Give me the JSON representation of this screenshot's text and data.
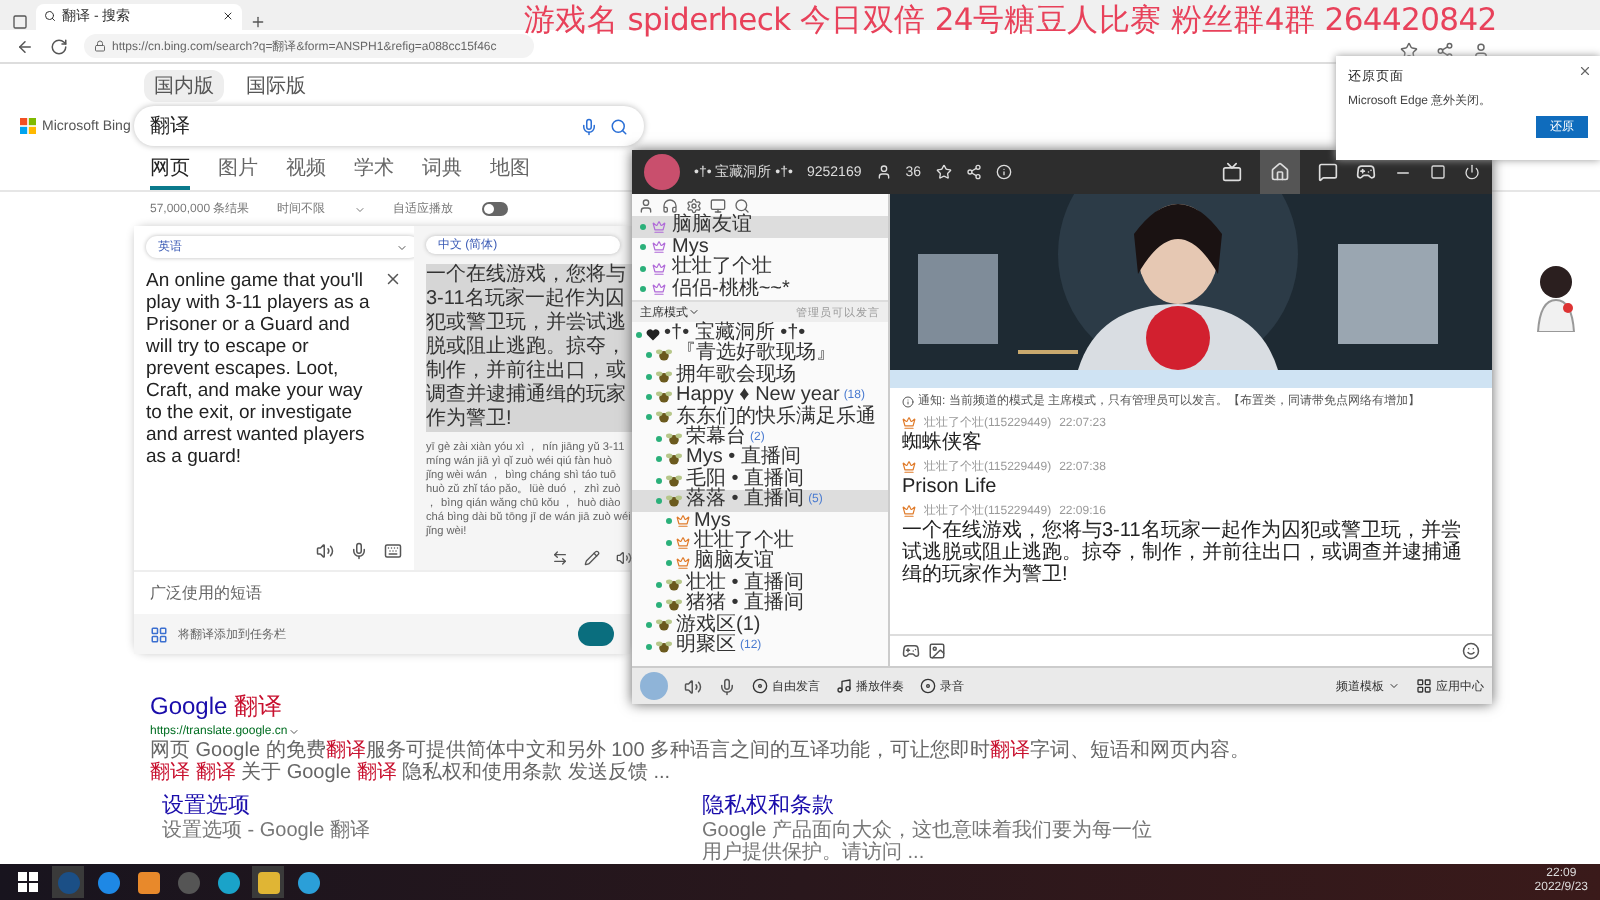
{
  "browser": {
    "tab_title": "翻译 - 搜索",
    "url": "https://cn.bing.com/search?q=翻译&form=ANSPH1&refig=a088cc15f46c"
  },
  "stream_overlay": "游戏名 spiderheck 今日双倍 24号糖豆人比赛 粉丝群4群 264420842",
  "bing": {
    "region_tabs": [
      {
        "label": "国内版",
        "selected": true
      },
      {
        "label": "国际版",
        "selected": false
      }
    ],
    "logo": "Microsoft Bing",
    "query": "翻译",
    "nav": [
      {
        "label": "网页",
        "selected": true
      },
      {
        "label": "图片",
        "selected": false
      },
      {
        "label": "视频",
        "selected": false
      },
      {
        "label": "学术",
        "selected": false
      },
      {
        "label": "词典",
        "selected": false
      },
      {
        "label": "地图",
        "selected": false
      }
    ],
    "result_count": "57,000,000 条结果",
    "time_filter": "时间不限",
    "autoplay": {
      "label": "自适应播放",
      "on": false
    },
    "translator": {
      "source_lang": "英语",
      "source_text": "An online game that you'll play with 3-11 players as a Prisoner or a Guard and will try to escape or prevent escapes. Loot, Craft, and make your way to the exit, or investigate and arrest wanted players as a guard!",
      "target_lang": "中文 (简体)",
      "target_text": "一个在线游戏，您将与3-11名玩家一起作为囚犯或警卫玩，并尝试逃脱或阻止逃跑。掠夺，制作，并前往出口，或调查并逮捕通缉的玩家作为警卫!",
      "pinyin": "yī gè zài xiàn yóu xì ， nín jiāng yǔ 3-11 míng wán jiā yì qǐ zuò wéi qiú fàn huò jǐng wèi wán ， bìng cháng shì táo tuō huò zǔ zhǐ táo pǎo。lüè duó ， zhì zuò ， bìng qián wǎng chū kǒu ， huò diào chá bìng dài bǔ tōng jī de wán jiā zuò wéi jǐng wèi!",
      "phrases_heading": "广泛使用的短语",
      "taskbar_prompt": "将翻译添加到任务栏"
    },
    "result": {
      "title": "Google **翻译**",
      "url": "https://translate.google.cn",
      "snippet": "网页 Google 的免费**翻译**服务可提供简体中文和另外 100 多种语言之间的互译功能，可让您即时**翻译**字词、短语和网页内容。**翻译** **翻译** 关于 Google **翻译** 隐私权和使用条款 发送反馈 ...",
      "sitelinks": [
        {
          "title": "设置选项",
          "description": "设置选项 - Google 翻译"
        },
        {
          "title": "隐私权和条款",
          "description": "Google 产品面向大众，这也意味着我们要为每一位用户提供保护。请访问 ..."
        }
      ]
    }
  },
  "edge_popup": {
    "title": "还原页面",
    "message": "Microsoft Edge 意外关闭。",
    "button": "还原"
  },
  "yy": {
    "channel_name": "•†• 宝藏洞所 •†•",
    "channel_id": "9252169",
    "online_count": "36",
    "members": [
      {
        "name": "脑脑友谊",
        "selected": true
      },
      {
        "name": "Mys",
        "selected": false
      },
      {
        "name": "壮壮了个壮",
        "selected": false
      },
      {
        "name": "侣侣-桃桃~~*",
        "selected": false
      }
    ],
    "mode": "主席模式",
    "mode_note": "管理员可以发言",
    "tree": [
      {
        "label": "•†• 宝藏洞所 •†•",
        "kind": "root",
        "selected": false,
        "children": [
          {
            "label": "『青选好歌现场』",
            "kind": "channel",
            "selected": false
          },
          {
            "label": "拥年歌会现场",
            "kind": "channel",
            "selected": false
          },
          {
            "label": "Happy ♦ New year",
            "count": "(18)",
            "kind": "channel",
            "selected": false
          },
          {
            "label": "东东们的快乐满足乐通",
            "kind": "channel",
            "selected": false,
            "children": [
              {
                "label": "荣幕台",
                "count": "(2)",
                "kind": "channel",
                "selected": false
              },
              {
                "label": "Mys • 直播间",
                "kind": "channel",
                "selected": false
              },
              {
                "label": "毛阳 • 直播间",
                "kind": "channel",
                "selected": false
              },
              {
                "label": "落落 • 直播间",
                "count": "(5)",
                "kind": "channel",
                "selected": true,
                "children": [
                  {
                    "label": "Mys",
                    "kind": "user",
                    "selected": false
                  },
                  {
                    "label": "壮壮了个壮",
                    "kind": "user",
                    "selected": false
                  },
                  {
                    "label": "脑脑友谊",
                    "kind": "user",
                    "selected": false
                  }
                ]
              },
              {
                "label": "壮壮 • 直播间",
                "kind": "channel",
                "selected": false
              },
              {
                "label": "猪猪 • 直播间",
                "kind": "channel",
                "selected": false
              }
            ]
          },
          {
            "label": "游戏区(1)",
            "kind": "channel",
            "selected": false
          },
          {
            "label": "明聚区",
            "count": "(12)",
            "kind": "channel",
            "selected": false
          }
        ]
      }
    ],
    "notice": "通知: 当前频道的模式是 主席模式，只有管理员可以发言。【布置类，同请带免点网络有增加】",
    "messages": [
      {
        "author": "壮壮了个壮(115229449)",
        "time": "22:07:23",
        "text": "蜘蛛侠客"
      },
      {
        "author": "壮壮了个壮(115229449)",
        "time": "22:07:38",
        "text": "Prison Life"
      },
      {
        "author": "壮壮了个壮(115229449)",
        "time": "22:09:16",
        "text": "一个在线游戏，您将与3-11名玩家一起作为囚犯或警卫玩，并尝试逃脱或阻止逃跑。掠夺，制作，并前往出口，或调查并逮捕通缉的玩家作为警卫!"
      }
    ],
    "toolbar": [
      "自由发言",
      "播放伴奏",
      "录音"
    ],
    "template": "频道模板",
    "app_center": "应用中心"
  },
  "taskbar": {
    "time": "22:09",
    "date": "2022/9/23"
  }
}
